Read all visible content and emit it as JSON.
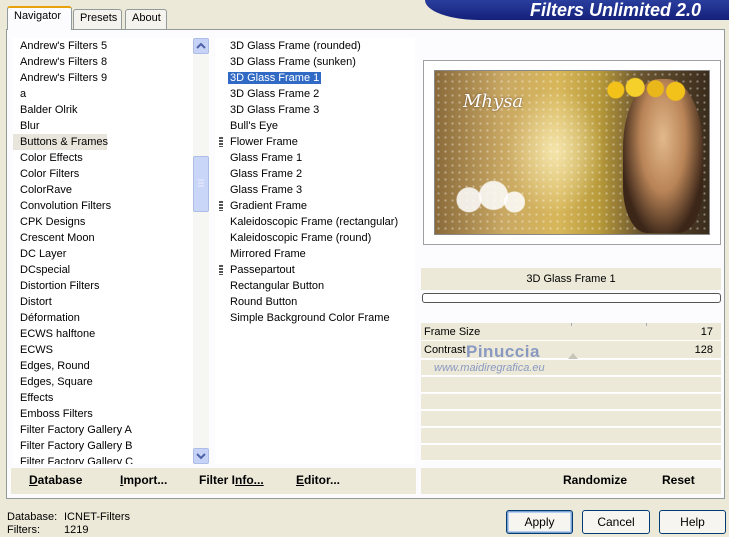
{
  "window": {
    "title": "Filters Unlimited 2.0"
  },
  "tabs": [
    {
      "label": "Navigator",
      "active": true
    },
    {
      "label": "Presets",
      "active": false
    },
    {
      "label": "About",
      "active": false
    }
  ],
  "categories": {
    "selected": "Buttons & Frames",
    "items": [
      "Andrew's Filters 5",
      "Andrew's Filters 8",
      "Andrew's Filters 9",
      "a",
      "Balder Olrik",
      "Blur",
      "Buttons & Frames",
      "Color Effects",
      "Color Filters",
      "ColorRave",
      "Convolution Filters",
      "CPK Designs",
      "Crescent Moon",
      "DC Layer",
      "DCspecial",
      "Distortion Filters",
      "Distort",
      "Déformation",
      "ECWS halftone",
      "ECWS",
      "Edges, Round",
      "Edges, Square",
      "Effects",
      "Emboss Filters",
      "Filter Factory Gallery A",
      "Filter Factory Gallery B",
      "Filter Factory Gallery C"
    ]
  },
  "filters": {
    "selected": "3D Glass Frame 1",
    "items": [
      {
        "label": "3D Glass Frame (rounded)",
        "grip": false
      },
      {
        "label": "3D Glass Frame (sunken)",
        "grip": false
      },
      {
        "label": "3D Glass Frame 1",
        "grip": false
      },
      {
        "label": "3D Glass Frame 2",
        "grip": false
      },
      {
        "label": "3D Glass Frame 3",
        "grip": false
      },
      {
        "label": "Bull's Eye",
        "grip": false
      },
      {
        "label": "Flower Frame",
        "grip": true
      },
      {
        "label": "Glass Frame 1",
        "grip": false
      },
      {
        "label": "Glass Frame 2",
        "grip": false
      },
      {
        "label": "Glass Frame 3",
        "grip": false
      },
      {
        "label": "Gradient Frame",
        "grip": true
      },
      {
        "label": "Kaleidoscopic Frame (rectangular)",
        "grip": false
      },
      {
        "label": "Kaleidoscopic Frame (round)",
        "grip": false
      },
      {
        "label": "Mirrored Frame",
        "grip": false
      },
      {
        "label": "Passepartout",
        "grip": true
      },
      {
        "label": "Rectangular Button",
        "grip": false
      },
      {
        "label": "Round Button",
        "grip": false
      },
      {
        "label": "Simple Background Color Frame",
        "grip": false
      }
    ]
  },
  "preview": {
    "signature": "Mhysa"
  },
  "params": {
    "filter_name": "3D Glass Frame 1",
    "progress_fraction": 0,
    "rows": [
      {
        "label": "Frame Size",
        "value": "17"
      },
      {
        "label": "Contrast",
        "value": "128"
      }
    ]
  },
  "watermark": {
    "line1": "Pinuccia",
    "line2": "www.maidiregrafica.eu"
  },
  "left_buttons": [
    {
      "first": "D",
      "rest": "atabase"
    },
    {
      "first": "I",
      "rest": "mport..."
    },
    {
      "first": "Filter I",
      "rest": "nfo..."
    },
    {
      "first": "E",
      "rest": "ditor..."
    }
  ],
  "right_buttons": {
    "randomize": "Randomize",
    "reset": "Reset"
  },
  "footer": {
    "database_label": "Database:",
    "database_value": "ICNET-Filters",
    "filters_label": "Filters:",
    "filters_value": "1219"
  },
  "dialog_buttons": {
    "apply": "Apply",
    "cancel": "Cancel",
    "help": "Help"
  },
  "colors": {
    "selection": "#316ac5",
    "banner": "#1a2a8a",
    "tab_accent": "#e6a10b"
  }
}
